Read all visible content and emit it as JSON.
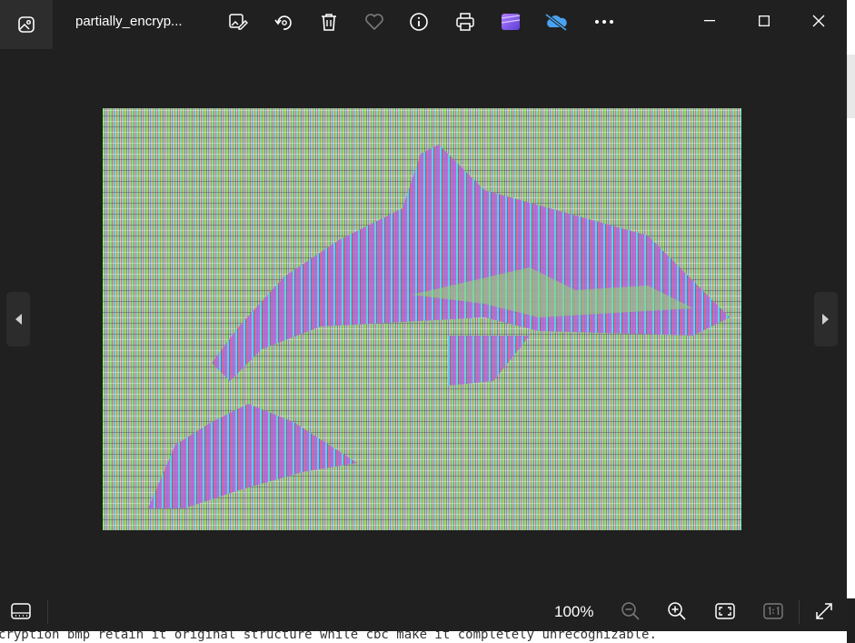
{
  "window": {
    "title": "partially_encryp...",
    "app_icon": "photos-app-icon"
  },
  "toolbar": {
    "items": [
      {
        "name": "edit-image-button",
        "icon": "edit-image-icon"
      },
      {
        "name": "rotate-button",
        "icon": "rotate-icon"
      },
      {
        "name": "delete-button",
        "icon": "trash-icon"
      },
      {
        "name": "favorite-button",
        "icon": "heart-icon"
      },
      {
        "name": "file-info-button",
        "icon": "info-icon"
      },
      {
        "name": "print-button",
        "icon": "printer-icon"
      },
      {
        "name": "clipchamp-button",
        "icon": "clipchamp-icon"
      },
      {
        "name": "onedrive-button",
        "icon": "onedrive-off-icon"
      },
      {
        "name": "more-options-button",
        "icon": "more-icon"
      }
    ]
  },
  "window_controls": {
    "minimize": "minimize-icon",
    "maximize": "maximize-icon",
    "close": "close-icon"
  },
  "viewer": {
    "prev_icon": "chevron-left-icon",
    "next_icon": "chevron-right-icon"
  },
  "bottom_bar": {
    "filmstrip_icon": "filmstrip-icon",
    "zoom_level": "100%",
    "zoom_out_icon": "zoom-out-icon",
    "zoom_in_icon": "zoom-in-icon",
    "fit_icon": "fit-to-window-icon",
    "actual_size_icon": "actual-size-icon",
    "fullscreen_icon": "fullscreen-icon"
  },
  "background_caption": "cryption bmp retain it original structure while cbc make it completely unrecognizable.",
  "colors": {
    "window_bg": "#202020",
    "icon_fg": "#ffffff",
    "icon_disabled": "#7a7a7a",
    "onedrive_blue": "#4aa3f0",
    "clipchamp_purple": "#8a5cf6"
  }
}
